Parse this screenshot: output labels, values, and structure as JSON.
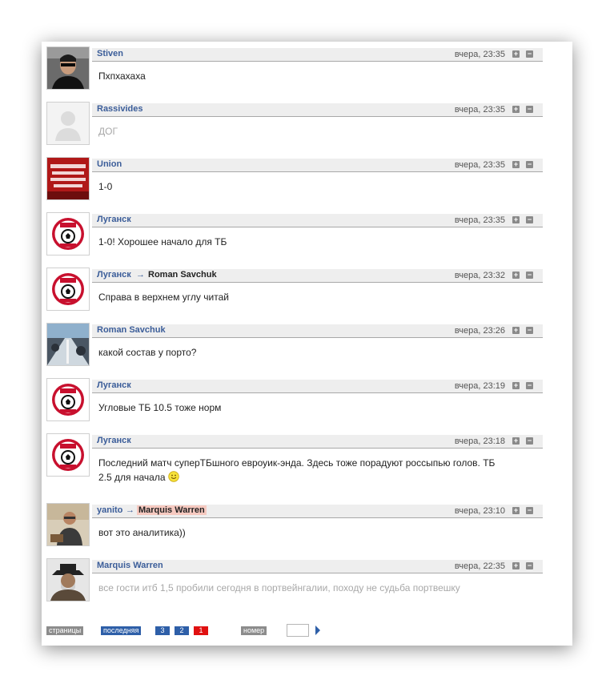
{
  "comments": [
    {
      "author": "Stiven",
      "time": "вчера, 23:35",
      "text": "Пхпхахаха",
      "avatar": "man-sunglasses"
    },
    {
      "author": "Rassivides",
      "time": "вчера, 23:35",
      "text": "ДОГ",
      "avatar": "default-silhouette",
      "faded": true
    },
    {
      "author": "Union",
      "time": "вчера, 23:35",
      "text": "1-0",
      "avatar": "spartak-banner"
    },
    {
      "author": "Луганск",
      "time": "вчера, 23:35",
      "text": "1-0! Хорошее начало для ТБ",
      "avatar": "zarya-logo"
    },
    {
      "author": "Луганск",
      "reply_to": "Roman Savchuk",
      "time": "вчера, 23:32",
      "text": "Справа в верхнем углу читай",
      "avatar": "zarya-logo"
    },
    {
      "author": "Roman Savchuk",
      "time": "вчера, 23:26",
      "text": "какой состав у порто?",
      "avatar": "photo-road"
    },
    {
      "author": "Луганск",
      "time": "вчера, 23:19",
      "text": "Угловые ТБ 10.5 тоже норм",
      "avatar": "zarya-logo"
    },
    {
      "author": "Луганск",
      "time": "вчера, 23:18",
      "text": "Последний матч суперТБшного евроуик-энда. Здесь тоже порадуют россыпью голов. ТБ",
      "text2": "2.5 для начала",
      "avatar": "zarya-logo",
      "smile": "smile-icon"
    },
    {
      "author": "yanito",
      "reply_to": "Marquis Warren",
      "reply_highlight": true,
      "time": "вчера, 23:10",
      "text": "вот это аналитика))",
      "avatar": "man-glasses"
    },
    {
      "author": "Marquis Warren",
      "time": "вчера, 22:35",
      "text": "все гости итб 1,5 пробили сегодня в портвейнгалии, походу не судьба портвешку",
      "avatar": "cowboy-hat",
      "faded": true
    }
  ],
  "vote": {
    "plus": "+",
    "minus": "−"
  },
  "pager": {
    "pages_label": "страницы",
    "last_label": "последняя",
    "pages": [
      "3",
      "2",
      "1"
    ],
    "current": "1",
    "number_label": "номер",
    "number_value": ""
  },
  "colors": {
    "link": "#3b5d99",
    "header_bg": "#eeeeee",
    "current_page": "#e01010",
    "page": "#2e5fa8",
    "highlight": "#f6c9c0"
  }
}
